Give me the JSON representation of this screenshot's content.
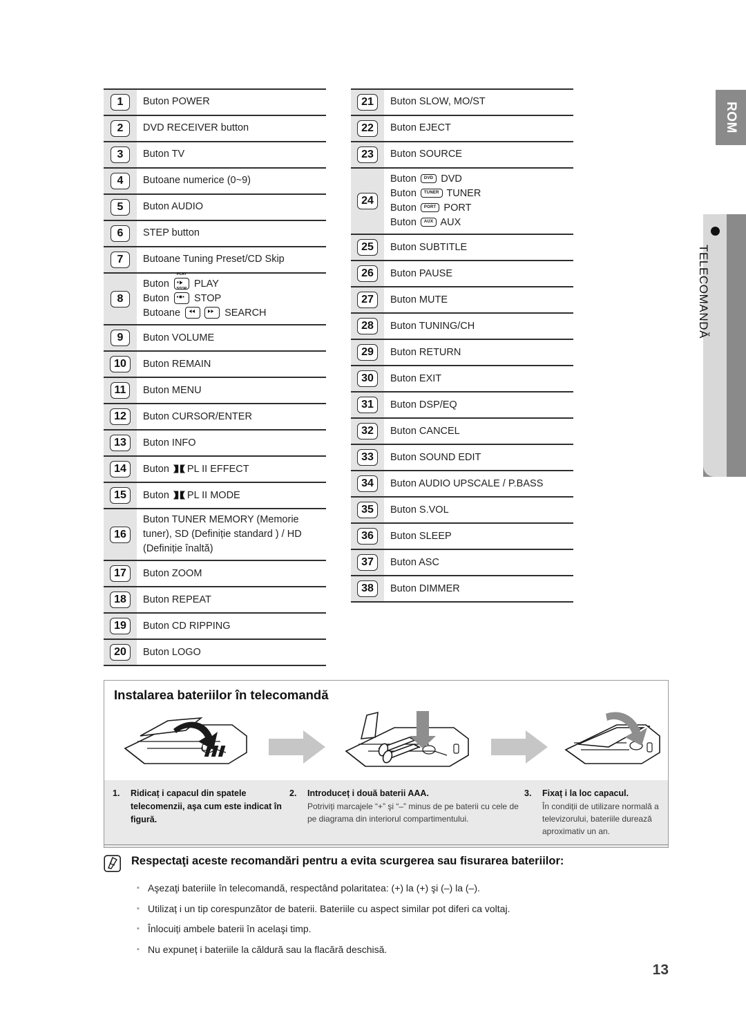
{
  "side": {
    "rom_label": "ROM",
    "chapter_label": "TELECOMANDĂ",
    "dot_icon": "bullet-dot-icon"
  },
  "table_left": [
    {
      "num": "1",
      "lines": [
        "Buton POWER"
      ]
    },
    {
      "num": "2",
      "lines": [
        "DVD RECEIVER button"
      ]
    },
    {
      "num": "3",
      "lines": [
        "Buton TV"
      ]
    },
    {
      "num": "4",
      "lines": [
        "Butoane numerice (0~9)"
      ]
    },
    {
      "num": "5",
      "lines": [
        "Buton AUDIO"
      ]
    },
    {
      "num": "6",
      "lines": [
        "STEP button"
      ]
    },
    {
      "num": "7",
      "lines": [
        "Butoane Tuning Preset/CD Skip"
      ]
    },
    {
      "num": "8",
      "lines": [
        "Buton  PLAY",
        "Buton  STOP",
        "Butoane  SEARCH"
      ],
      "icons": true
    },
    {
      "num": "9",
      "lines": [
        "Buton VOLUME"
      ]
    },
    {
      "num": "10",
      "lines": [
        "Buton REMAIN"
      ]
    },
    {
      "num": "11",
      "lines": [
        "Buton MENU"
      ]
    },
    {
      "num": "12",
      "lines": [
        "Buton CURSOR/ENTER"
      ]
    },
    {
      "num": "13",
      "lines": [
        "Buton INFO"
      ]
    },
    {
      "num": "14",
      "lines": [
        "Buton  PL II EFFECT"
      ],
      "dolby": true
    },
    {
      "num": "15",
      "lines": [
        "Buton  PL II MODE"
      ],
      "dolby": true
    },
    {
      "num": "16",
      "lines": [
        "Buton TUNER MEMORY (Memorie tuner), SD (Definiție standard ) / HD (Definiție înaltă)"
      ]
    },
    {
      "num": "17",
      "lines": [
        "Buton ZOOM"
      ]
    },
    {
      "num": "18",
      "lines": [
        "Buton REPEAT"
      ]
    },
    {
      "num": "19",
      "lines": [
        "Buton CD RIPPING"
      ]
    },
    {
      "num": "20",
      "lines": [
        "Buton LOGO"
      ]
    }
  ],
  "table_right": [
    {
      "num": "21",
      "lines": [
        "Buton SLOW, MO/ST"
      ]
    },
    {
      "num": "22",
      "lines": [
        "Buton EJECT"
      ]
    },
    {
      "num": "23",
      "lines": [
        "Buton SOURCE"
      ]
    },
    {
      "num": "24",
      "lines": [
        "Buton  DVD",
        "Buton  TUNER",
        "Buton  PORT",
        "Buton  AUX"
      ],
      "source_keys": [
        "DVD",
        "TUNER",
        "PORT",
        "AUX"
      ]
    },
    {
      "num": "25",
      "lines": [
        "Buton SUBTITLE"
      ]
    },
    {
      "num": "26",
      "lines": [
        "Buton PAUSE"
      ]
    },
    {
      "num": "27",
      "lines": [
        "Buton MUTE"
      ]
    },
    {
      "num": "28",
      "lines": [
        "Buton TUNING/CH"
      ]
    },
    {
      "num": "29",
      "lines": [
        "Buton RETURN"
      ]
    },
    {
      "num": "30",
      "lines": [
        "Buton EXIT"
      ]
    },
    {
      "num": "31",
      "lines": [
        "Buton DSP/EQ"
      ]
    },
    {
      "num": "32",
      "lines": [
        "Buton CANCEL"
      ]
    },
    {
      "num": "33",
      "lines": [
        "Buton SOUND EDIT"
      ]
    },
    {
      "num": "34",
      "lines": [
        "Buton AUDIO UPSCALE / P.BASS"
      ]
    },
    {
      "num": "35",
      "lines": [
        "Buton S.VOL"
      ]
    },
    {
      "num": "36",
      "lines": [
        "Buton SLEEP"
      ]
    },
    {
      "num": "37",
      "lines": [
        "Buton ASC"
      ]
    },
    {
      "num": "38",
      "lines": [
        "Buton DIMMER"
      ]
    }
  ],
  "item8_keys": {
    "play": "PLAY",
    "stop": "STOP",
    "search_rew": "search-rewind-icon",
    "search_ff": "search-forward-icon"
  },
  "battery": {
    "title": "Instalarea bateriilor în telecomandă",
    "steps": [
      {
        "n": "1.",
        "title": "Ridicaț i capacul din spatele telecomenzii, aşa cum este indicat în figură.",
        "text": ""
      },
      {
        "n": "2.",
        "title": "Introduceț i două baterii AAA.",
        "text": "Potriviți marcajele “+” şi “–” minus de pe baterii cu cele de pe diagrama din interiorul compartimentului."
      },
      {
        "n": "3.",
        "title": "Fixaț i la loc capacul.",
        "text": "În condiții de utilizare normală a televizorului, bateriile durează aproximativ un an."
      }
    ]
  },
  "notes": {
    "icon": "note-pencil-icon",
    "heading": "Respectaţi aceste recomandări pentru a evita scurgerea sau fisurarea bateriilor:",
    "bullet_glyph": "▪",
    "bullets": [
      "Aşezaţi bateriile în telecomandă, respectând polaritatea: (+) la (+) şi (–) la (–).",
      "Utilizaț i un tip corespunzător de baterii. Bateriile cu aspect similar pot diferi ca voltaj.",
      "Înlocuiți ambele baterii în acelaşi timp.",
      "Nu expuneț i bateriile la căldură sau la flacără deschisă."
    ]
  },
  "page_number": "13"
}
